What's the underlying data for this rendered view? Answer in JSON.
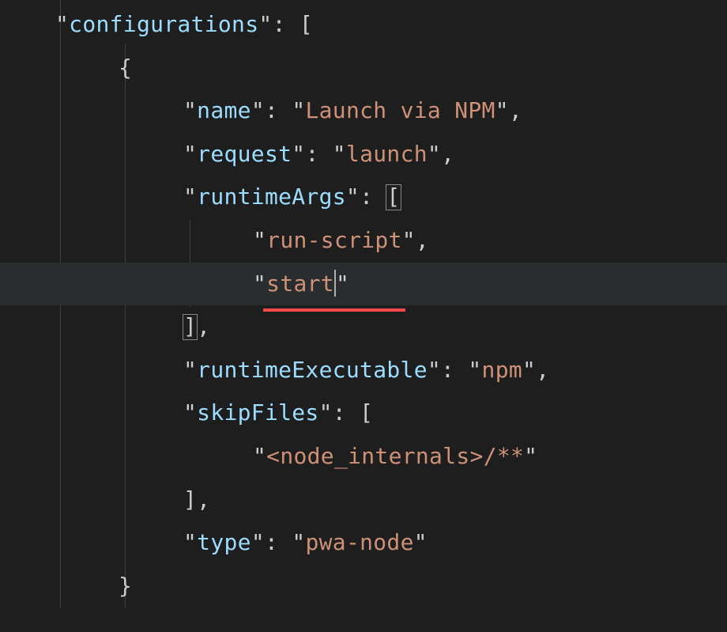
{
  "code": {
    "keys": {
      "configurations": "configurations",
      "name": "name",
      "request": "request",
      "runtimeArgs": "runtimeArgs",
      "runtimeExecutable": "runtimeExecutable",
      "skipFiles": "skipFiles",
      "type": "type"
    },
    "values": {
      "name": "Launch via NPM",
      "request": "launch",
      "runtimeArgs0": "run-script",
      "runtimeArgs1": "start",
      "runtimeExecutable": "npm",
      "skipFiles0": "<node_internals>/**",
      "type": "pwa-node"
    },
    "punct": {
      "q": "\"",
      "colon": ": ",
      "comma": ",",
      "lbracket": "[",
      "rbracket": "]",
      "lbrace": "{",
      "rbrace": "}"
    }
  }
}
